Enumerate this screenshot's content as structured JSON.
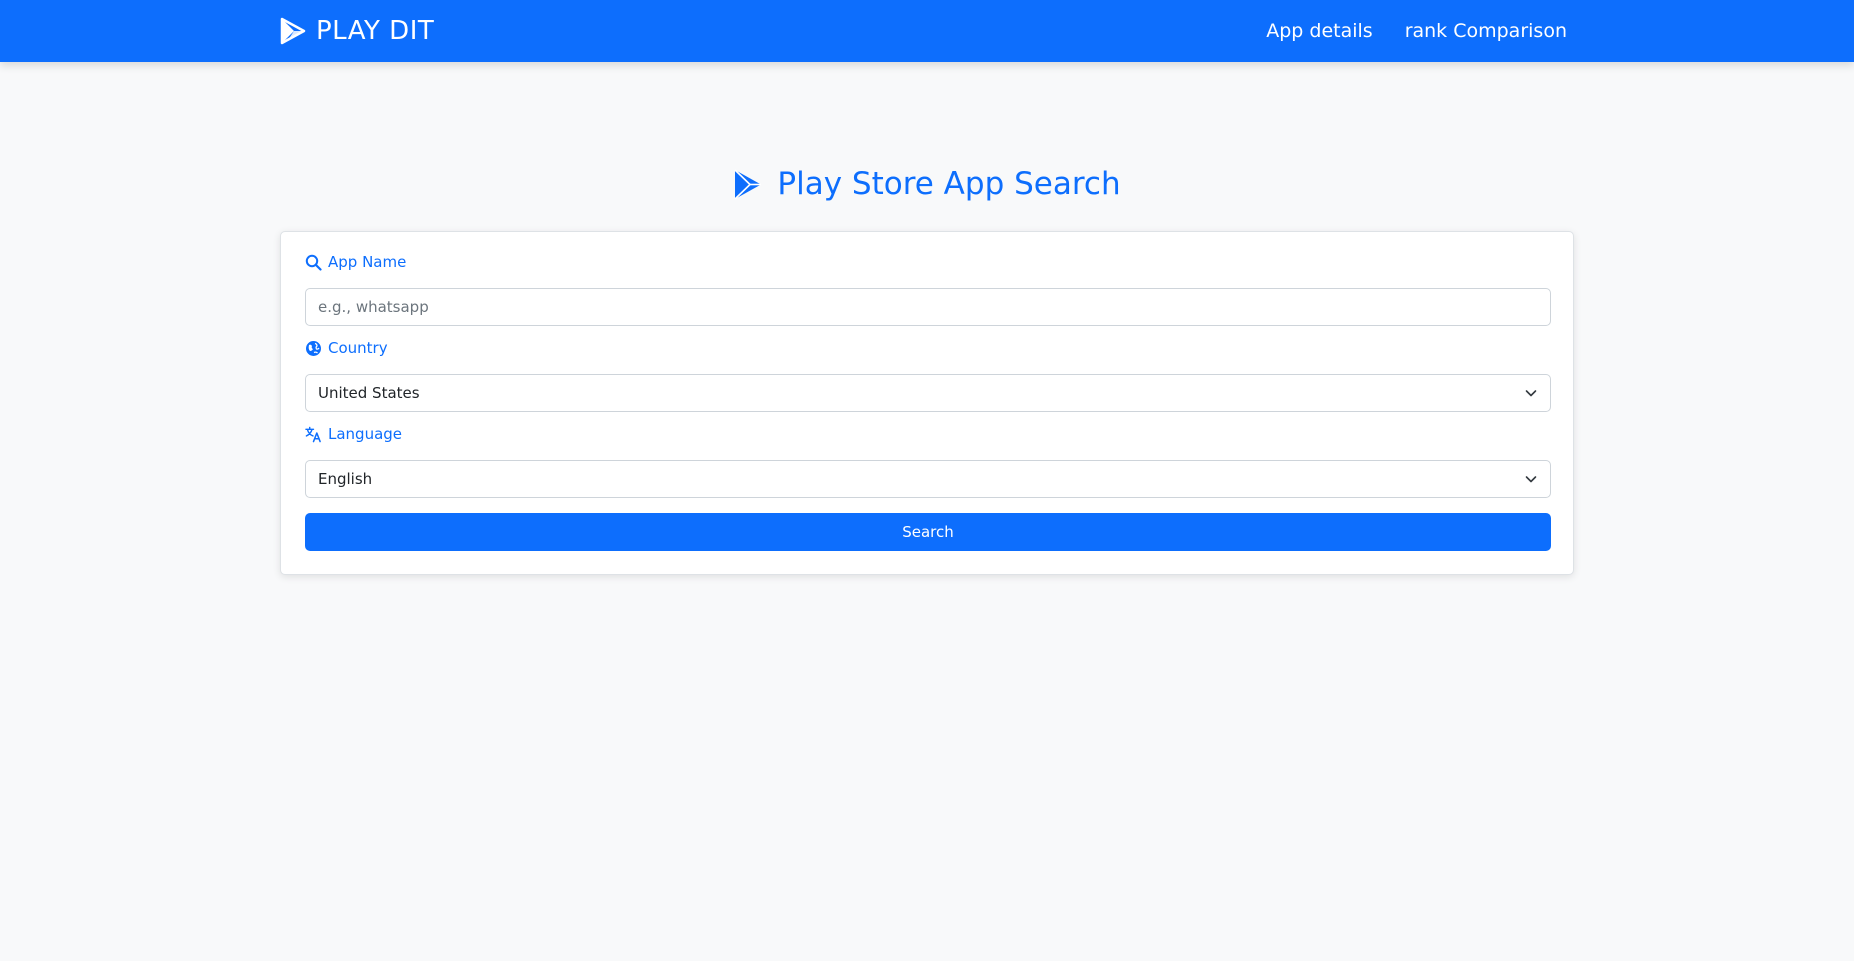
{
  "navbar": {
    "brand": "PLAY DIT",
    "links": [
      "App details",
      "rank Comparison"
    ]
  },
  "page": {
    "heading": "Play Store App Search"
  },
  "form": {
    "app_name_label": "App Name",
    "app_name_placeholder": "e.g., whatsapp",
    "app_name_value": "",
    "country_label": "Country",
    "country_value": "United States",
    "language_label": "Language",
    "language_value": "English",
    "search_label": "Search"
  },
  "icons": {
    "brand": "play-icon",
    "heading": "play-icon",
    "app_name": "search-icon",
    "country": "globe-icon",
    "language": "translate-icon",
    "select": "chevron-down-icon"
  },
  "colors": {
    "primary": "#0d6efd",
    "background": "#f8f9fa",
    "card": "#ffffff"
  }
}
